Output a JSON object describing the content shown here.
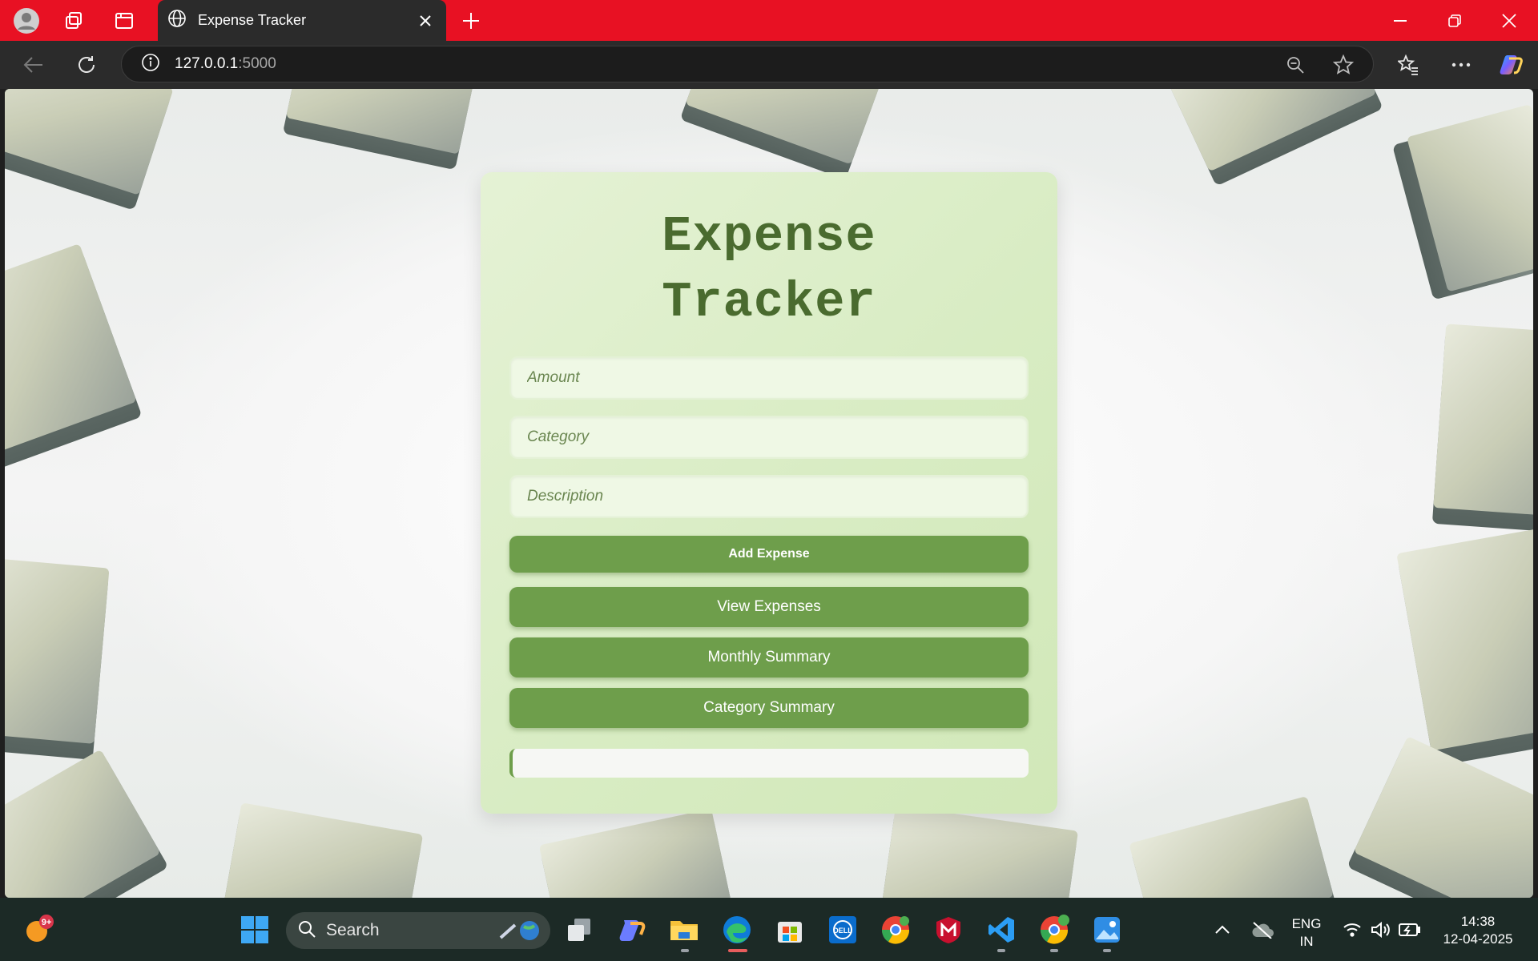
{
  "browser": {
    "tab_title": "Expense Tracker",
    "url_host": "127.0.0.1",
    "url_port": ":5000"
  },
  "page": {
    "title_line1": "Expense",
    "title_line2": "Tracker",
    "amount_placeholder": "Amount",
    "category_placeholder": "Category",
    "description_placeholder": "Description",
    "add_button": "Add Expense",
    "view_button": "View Expenses",
    "monthly_button": "Monthly Summary",
    "category_button": "Category Summary",
    "output_text": ""
  },
  "taskbar": {
    "search_label": "Search",
    "notification_badge": "9+",
    "lang_top": "ENG",
    "lang_bottom": "IN",
    "time": "14:38",
    "date": "12-04-2025"
  },
  "colors": {
    "tabbar": "#e81123",
    "accent_green": "#6e9e4b",
    "title_green": "#4a6b2f"
  }
}
